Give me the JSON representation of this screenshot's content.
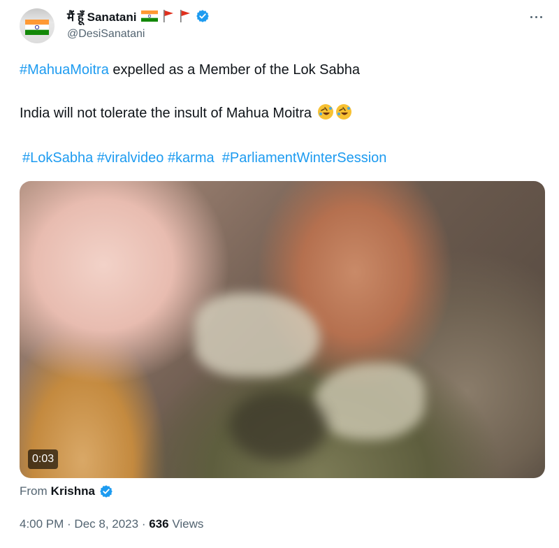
{
  "author": {
    "name": "मैं हूँ Sanatani",
    "handle": "@DesiSanatani"
  },
  "tweet": {
    "line1_hashtag": "#MahuaMoitra",
    "line1_text": " expelled as a Member of the Lok Sabha",
    "line2_text": "India will not tolerate the insult of Mahua Moitra ",
    "line3_hashtags": [
      "#LokSabha",
      "#viralvideo",
      "#karma",
      "#ParliamentWinterSession"
    ],
    "line3_hashtag_1": "#LokSabha",
    "line3_hashtag_2": "#viralvideo",
    "line3_hashtag_3": "#karma",
    "line3_hashtag_4": "#ParliamentWinterSession"
  },
  "video": {
    "duration": "0:03"
  },
  "attribution": {
    "prefix": "From",
    "source": "Krishna"
  },
  "meta": {
    "time": "4:00 PM",
    "separator": " · ",
    "date": "Dec 8, 2023",
    "views_count": "636",
    "views_label": " Views"
  },
  "icons": {
    "verified": "verified-badge-icon",
    "flag": "india-flag-icon",
    "red_flag": "red-flag-icon",
    "laugh": "rolling-laughing-emoji-icon",
    "more": "more-options-icon"
  },
  "colors": {
    "link": "#1d9bf0",
    "verified": "#1d9bf0",
    "text": "#0f1419",
    "muted": "#536471"
  }
}
